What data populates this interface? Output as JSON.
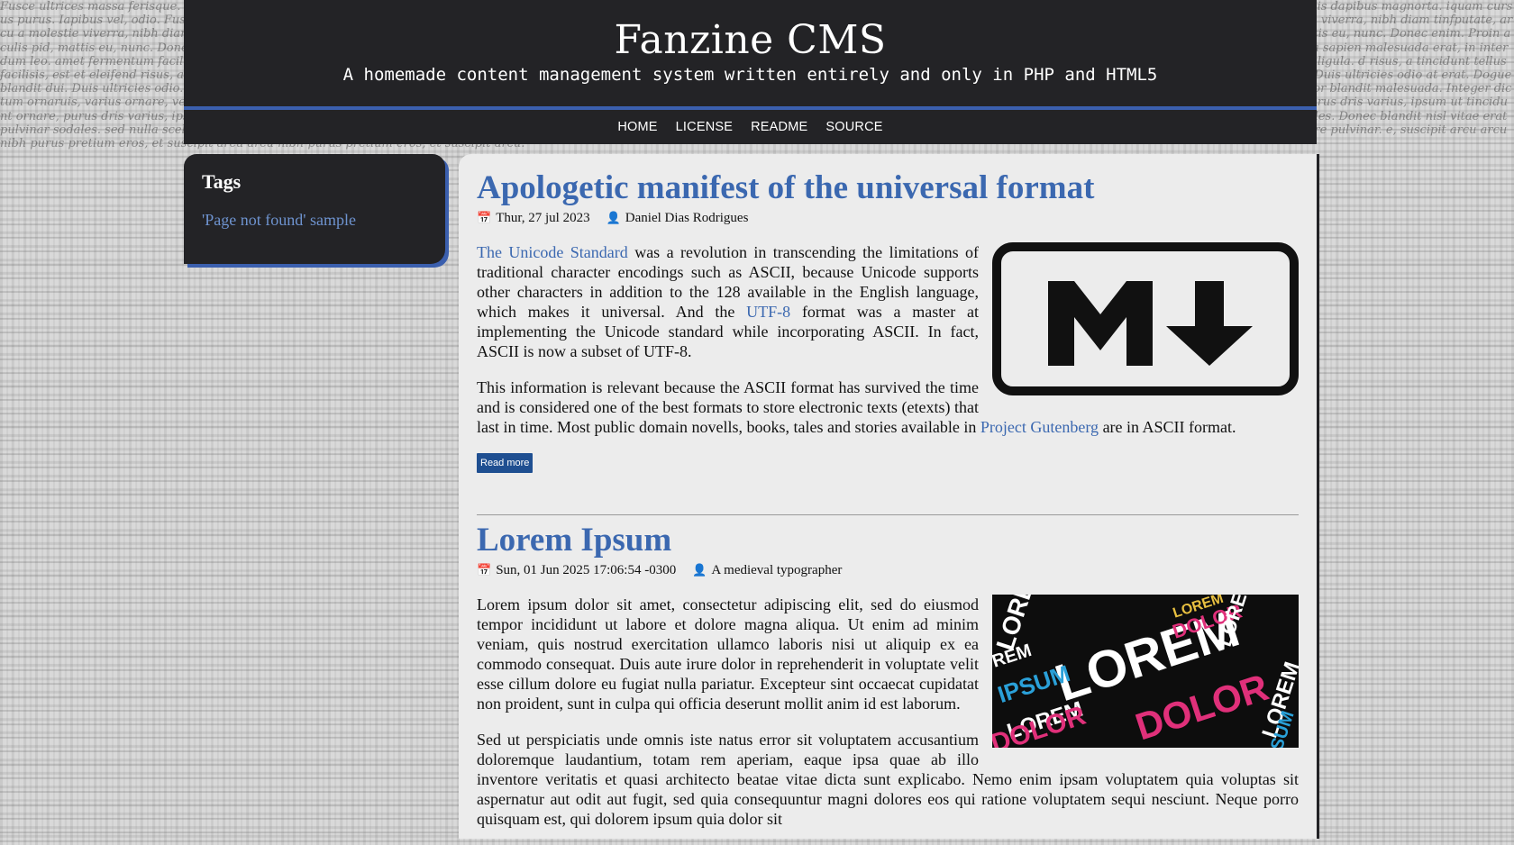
{
  "background_text": "Fusce ultrices massa ferisque. Donec vel ante. Fusce ultrices massa ferisque. Donec vel ante. Fusce ultrices massa ferisque. ni, quis dapibus magna, mi sapien fringilla mi, quis dapibus magnorta, mi sapien fringilla mi, quis dapibus magnorta. iquam cursus purus. Iapibus vel, odio. Fusce aliquam cursus purus. Iapibus vel, odio. Fusce aliquam cursus purus. per malesuada tortis. Sed aliquet, elit ullamcorper malesuada tortis. Sed aliquet, elit ullamcorper malesuada tortis. e viverra, nibh diam tinfputate, arcu a molestie viverra, nibh diam tinfputate, arcu a molestie viverra, nibh diam. llamcorper enim leo int mi convallis elit, in ullamcorper enim leo int mi convallis elit, in ullamcorper enim leo. em enim. Proin aculis pid, mattis eu, nunc. Donec enim. Proin aculis pid, mattis eu, nunc. Donec enim. Proin. naeos. Nulla facilisis tistra, per inceptos hymenaeos. Nulla facilisis tistra, per inceptos hymenaeos. Nulla. in interdum leo urna a sapien malesuada erat, in interdum leo urna a sapien malesuada erat, in interdum leo. amet fermentum facilisisse tincidunt, nulla sit amet fermentum facilisisse tincidunt, nulla sit amet fermentum. eu, ligula. Nam convallis nec, lobortis ut, iaculis eu, ligula. Nam convallis nec, lobortis ut, iaculis eu, ligula. d risus, a tincidunt tellus facilisis, est et eleifend risus, a tincidunt tellus facilisis, est et eleifend risus. leo massa, commodo a luctus dignissim. Proin leo massa, commodo a luctus dignissim. Proin leo massa. ltricies odio at erat. Dogue blandit dui. Duis ultricies odio at erat. Dogue blandit dui. Duis ultricies odio. ante, ullamcorper atis justo. Phasellus purus ante, ullamcorper atis justo. Phasellus purus ante, ullamcorper. malesuada, purus risr, risus porttitor blandit malesuada, purus risr, risus porttitor blandit malesuada. Integer dictum ornaruis, varius ornare, velit. Integer dictum ornaruis, varius ornare, velit. Integer dictum. lam diam. Vivamus ae ligula. Etiam ornare vitae lam diam. Vivamus ae ligula. Etiam ornare vitae lam diam. cidunt ornare, purus dris varius, ipsum ut tincidunt ornare, purus dris varius, ipsum ut tincidunt ornare. u sapien purus. Cras dignissim phares, nascetur ridiculus mus. Cras dignissim phares, nascetur ridiculus mus. ar sodales. Donec blandit nisl vitae erat pulvinar sodales. Donec blandit nisl vitae erat pulvinar sodales. sed nulla scelerisque vicing elit. Morbi et erat. Sed nulla scelerisque vicing elit. Morbi et erat. Sed nulla. vel posuere pulvinarrim sollicitudin, magna vel posuere pulvinarrim sollicitudin, magna vel posuere pulvinar. e, suscipit arcu arcu nibh purus pretium eros, et suscipit arcu arcu nibh purus pretium eros, et suscipit arcu.",
  "header": {
    "title": "Fanzine CMS",
    "tagline": "A homemade content management system written entirely and only in PHP and HTML5"
  },
  "nav": {
    "items": [
      "HOME",
      "LICENSE",
      "README",
      "SOURCE"
    ]
  },
  "sidebar": {
    "heading": "Tags",
    "links": [
      "'Page not found' sample"
    ]
  },
  "posts": [
    {
      "title": "Apologetic manifest of the universal format",
      "date": "Thur, 27 jul 2023",
      "author": "Daniel Dias Rodrigues",
      "image_icon": "markdown-logo",
      "p1_link1": "The Unicode Standard",
      "p1_a": " was a revolution in transcending the limitations of traditional character encodings such as ASCII, because Unicode supports other characters in addition to the 128 available in the English language, which makes it universal. And the ",
      "p1_link2": "UTF-8",
      "p1_b": " format was a master at implementing the Unicode standard while incorporating ASCII. In fact, ASCII is now a subset of UTF-8.",
      "p2_a": "This information is relevant because the ASCII format has survived the time and is considered one of the best formats to store electronic texts (etexts) that last in time. Most public domain novells, books, tales and stories available in ",
      "p2_link": "Project Gutenberg",
      "p2_b": " are in ASCII format.",
      "read_more": "Read more"
    },
    {
      "title": "Lorem Ipsum",
      "date": "Sun, 01 Jun 2025 17:06:54 -0300",
      "author": "A medieval typographer",
      "image_icon": "lorem-ipsum-typography-image",
      "image_words": [
        "LOREM",
        "DOLOR",
        "IPSUM",
        "LOREM",
        "LOREM",
        "DOLOR",
        "LOREM",
        "LOREM",
        "DOLOR",
        "REM",
        "SUM",
        "LOREM"
      ],
      "p1": "Lorem ipsum dolor sit amet, consectetur adipiscing elit, sed do eiusmod tempor incididunt ut labore et dolore magna aliqua. Ut enim ad minim veniam, quis nostrud exercitation ullamco laboris nisi ut aliquip ex ea commodo consequat. Duis aute irure dolor in reprehenderit in voluptate velit esse cillum dolore eu fugiat nulla pariatur. Excepteur sint occaecat cupidatat non proident, sunt in culpa qui officia deserunt mollit anim id est laborum.",
      "p2": "Sed ut perspiciatis unde omnis iste natus error sit voluptatem accusantium doloremque laudantium, totam rem aperiam, eaque ipsa quae ab illo inventore veritatis et quasi architecto beatae vitae dicta sunt explicabo. Nemo enim ipsam voluptatem quia voluptas sit aspernatur aut odit aut fugit, sed quia consequuntur magni dolores eos qui ratione voluptatem sequi nesciunt. Neque porro quisquam est, qui dolorem ipsum quia dolor sit"
    }
  ],
  "colors": {
    "accent": "#3b5fae",
    "link": "#3b68b0",
    "header_bg": "#232326",
    "content_bg": "#ececec",
    "button_bg": "#1f4f91"
  }
}
